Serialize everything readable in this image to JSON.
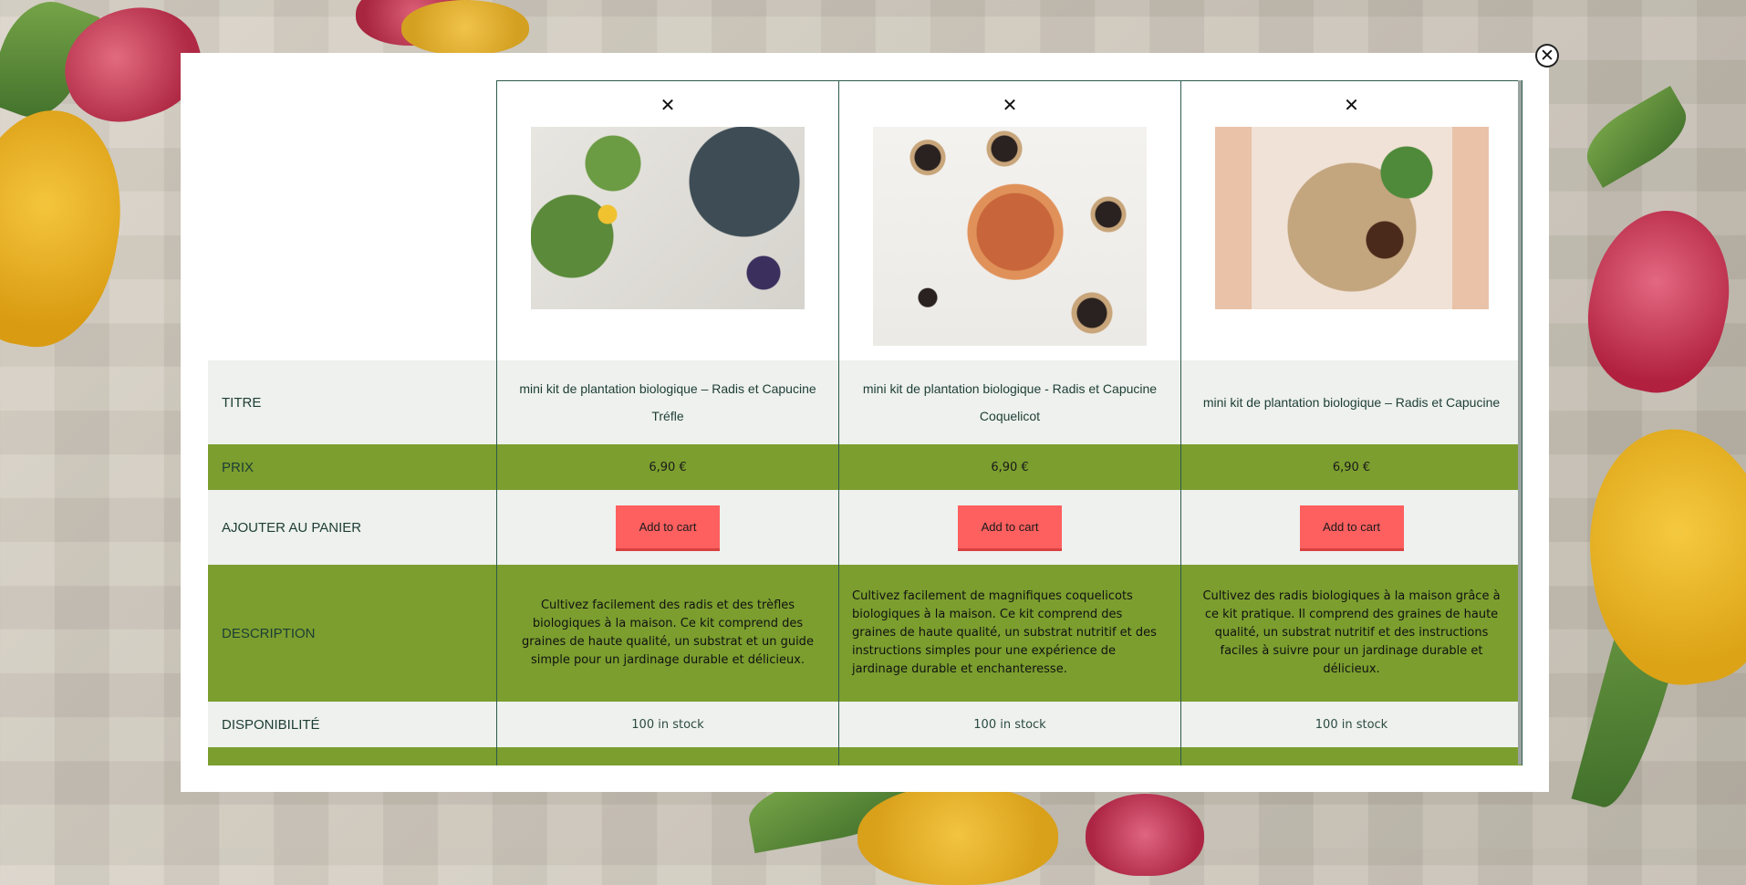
{
  "modal": {
    "close_symbol": "✕"
  },
  "labels": {
    "title": "TITRE",
    "price": "PRIX",
    "cart": "AJOUTER AU PANIER",
    "description": "DESCRIPTION",
    "availability": "DISPONIBILITÉ"
  },
  "products": [
    {
      "remove_symbol": "✕",
      "title": "mini kit de plantation biologique – Radis et Capucine Tréfle",
      "price": "6,90 €",
      "cart_label": "Add to cart",
      "description": "Cultivez facilement des radis et des trèfles biologiques à la maison. Ce kit comprend des graines de haute qualité, un substrat et un guide simple pour un jardinage durable et délicieux.",
      "stock": "100 in stock"
    },
    {
      "remove_symbol": "✕",
      "title": "mini kit de plantation biologique - Radis et Capucine Coquelicot",
      "price": "6,90 €",
      "cart_label": "Add to cart",
      "description": "Cultivez facilement de magnifiques coquelicots biologiques à la maison. Ce kit comprend des graines de haute qualité, un substrat nutritif et des instructions simples pour une expérience de jardinage durable et enchanteresse.",
      "stock": "100 in stock"
    },
    {
      "remove_symbol": "✕",
      "title": "mini kit de plantation biologique – Radis et Capucine",
      "price": "6,90 €",
      "cart_label": "Add to cart",
      "description": "Cultivez des radis biologiques à la maison grâce à ce kit pratique. Il comprend des graines de haute qualité, un substrat nutritif et des instructions faciles à suivre pour un jardinage durable et délicieux.",
      "stock": "100 in stock"
    }
  ],
  "colors": {
    "accent_green": "#7b9e2e",
    "row_light": "#eef1ee",
    "cart_button": "#fe5f5f",
    "border": "#2e5a4e"
  }
}
